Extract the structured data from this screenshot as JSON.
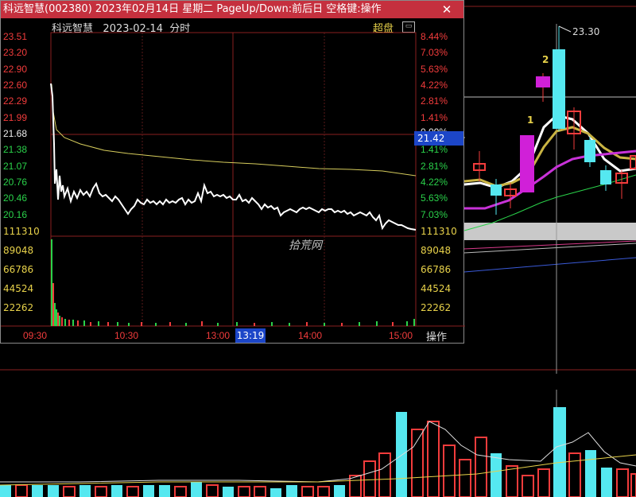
{
  "window": {
    "title": "科远智慧(002380)  2023年02月14日  星期二  PageUp/Down:前后日  空格键:操作",
    "close_icon": "close-icon"
  },
  "intraday": {
    "stock_name": "科远智慧",
    "date": "2023-02-14",
    "mode": "分时",
    "superpose_label": "超盘",
    "prices_left": [
      "23.51",
      "23.20",
      "22.90",
      "22.60",
      "22.29",
      "21.99",
      "21.68",
      "21.38",
      "21.07",
      "20.76",
      "20.46",
      "20.16"
    ],
    "pct_right": [
      "8.44%",
      "7.03%",
      "5.63%",
      "4.22%",
      "2.81%",
      "1.41%",
      "0.00%",
      "1.41%",
      "2.81%",
      "4.22%",
      "5.63%",
      "7.03%"
    ],
    "volume_left": [
      "111310",
      "89048",
      "66786",
      "44524",
      "22262"
    ],
    "volume_right": [
      "111310",
      "89048",
      "66786",
      "44524",
      "22262"
    ],
    "time_labels": [
      "09:30",
      "10:30",
      "13:00",
      "14:00",
      "15:00"
    ],
    "cursor_time": "13:19",
    "cursor_price": "21.42",
    "operate_label": "操作",
    "watermark": "拾荒网",
    "colors": {
      "title_bar": "#c5303e",
      "up": "#f23c3c",
      "down": "#2ad24a",
      "avg_line": "#d6cc5c",
      "price_line": "#ffffff",
      "cursor_box": "#1c46c8"
    }
  },
  "kline": {
    "peak_label": "23.30",
    "marker_1": "1",
    "marker_2": "2"
  }
}
